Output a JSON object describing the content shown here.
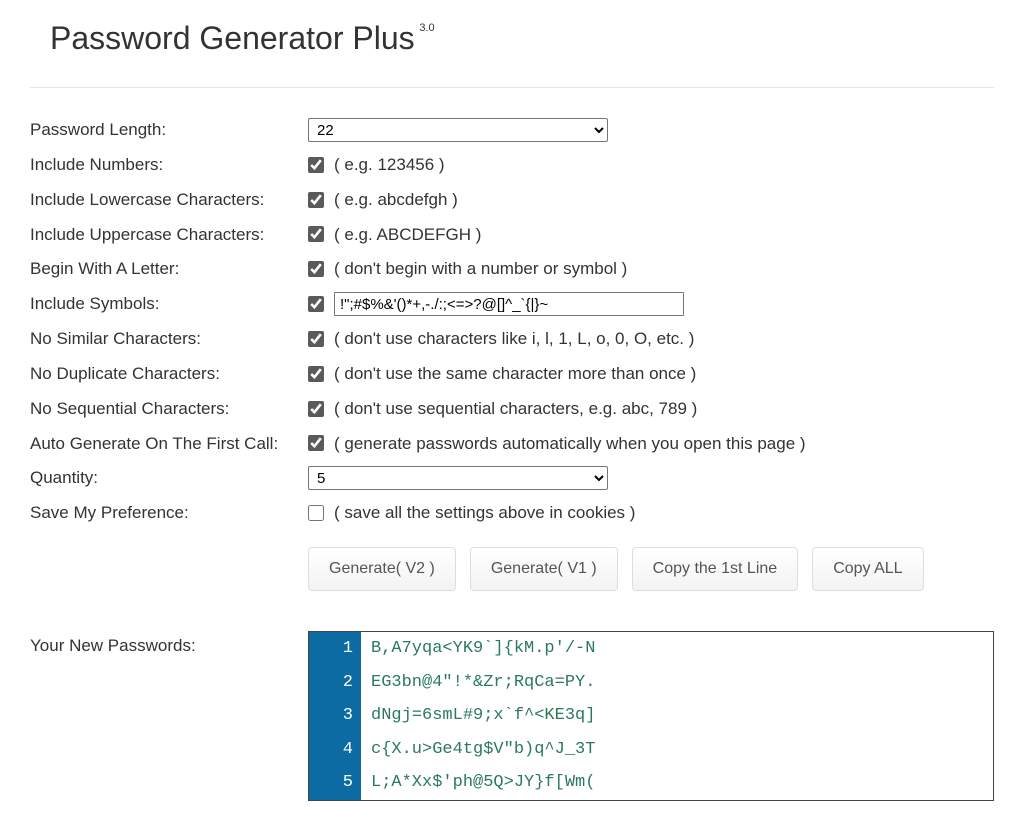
{
  "header": {
    "title": "Password Generator Plus",
    "version": "3.0"
  },
  "options": {
    "passwordLength": {
      "label": "Password Length:",
      "value": "22"
    },
    "includeNumbers": {
      "label": "Include Numbers:",
      "hint": "( e.g. 123456 )",
      "checked": true
    },
    "includeLowercase": {
      "label": "Include Lowercase Characters:",
      "hint": "( e.g. abcdefgh )",
      "checked": true
    },
    "includeUppercase": {
      "label": "Include Uppercase Characters:",
      "hint": "( e.g. ABCDEFGH )",
      "checked": true
    },
    "beginWithLetter": {
      "label": "Begin With A Letter:",
      "hint": "( don't begin with a number or symbol )",
      "checked": true
    },
    "includeSymbols": {
      "label": "Include Symbols:",
      "value": "!\";#$%&'()*+,-./:;<=>?@[]^_`{|}~",
      "checked": true
    },
    "noSimilar": {
      "label": "No Similar Characters:",
      "hint": "( don't use characters like i, l, 1, L, o, 0, O, etc. )",
      "checked": true
    },
    "noDuplicate": {
      "label": "No Duplicate Characters:",
      "hint": "( don't use the same character more than once )",
      "checked": true
    },
    "noSequential": {
      "label": "No Sequential Characters:",
      "hint": "( don't use sequential characters, e.g. abc, 789 )",
      "checked": true
    },
    "autoGenerate": {
      "label": "Auto Generate On The First Call:",
      "hint": "( generate passwords automatically when you open this page )",
      "checked": true
    },
    "quantity": {
      "label": "Quantity:",
      "value": "5"
    },
    "savePreference": {
      "label": "Save My Preference:",
      "hint": "( save all the settings above in cookies )",
      "checked": false
    }
  },
  "buttons": {
    "generateV2": "Generate( V2 )",
    "generateV1": "Generate( V1 )",
    "copyFirst": "Copy the 1st Line",
    "copyAll": "Copy ALL"
  },
  "results": {
    "label": "Your New Passwords:",
    "passwords": [
      "B,A7yqa<YK9`]{kM.p'/-N",
      "EG3bn@4\"!*&Zr;RqCa=PY.",
      "dNgj=6smL#9;x`f^<KE3q]",
      "c{X.u>Ge4tg$V\"b)q^J_3T",
      "L;A*Xx$'ph@5Q>JY}f[Wm("
    ]
  }
}
